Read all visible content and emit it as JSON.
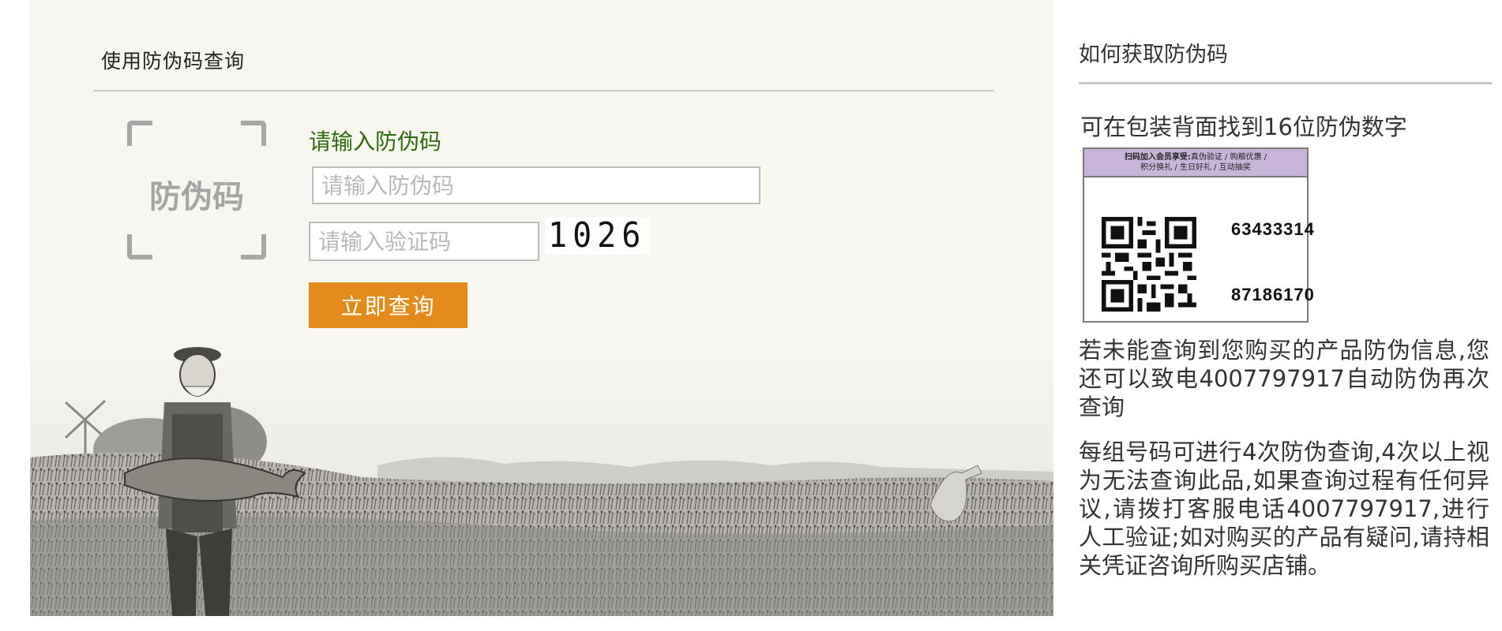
{
  "query_panel": {
    "title": "使用防伪码查询",
    "badge_text": "防伪码",
    "field_label": "请输入防伪码",
    "code_placeholder": "请输入防伪码",
    "verify_placeholder": "请输入验证码",
    "captcha": "1026",
    "submit_label": "立即查询"
  },
  "help_panel": {
    "title": "如何获取防伪码",
    "location_text": "可在包装背面找到16位防伪数字",
    "label_example": {
      "header_line1_bold": "扫码加入会员享受:",
      "header_line1_rest": "真伪验证 / 购粮优惠 /",
      "header_line2": "积分换礼 / 生日好礼 / 互动抽奖",
      "serial_line1": "63433314",
      "serial_line2": "87186170"
    },
    "phone_text": "若未能查询到您购买的产品防伪信息,您还可以致电4007797917自动防伪再次查询",
    "rules_text": "每组号码可进行4次防伪查询,4次以上视为无法查询此品,如果查询过程有任何异议,请拨打客服电话4007797917,进行人工验证;如对购买的产品有疑问,请持相关凭证咨询所购买店铺。"
  },
  "colors": {
    "accent_button": "#e38a1d",
    "label_green": "#2f6a11",
    "label_header_purple": "#c9b5d9"
  },
  "icons": [
    "scan-frame-icon",
    "qr-code-icon"
  ]
}
